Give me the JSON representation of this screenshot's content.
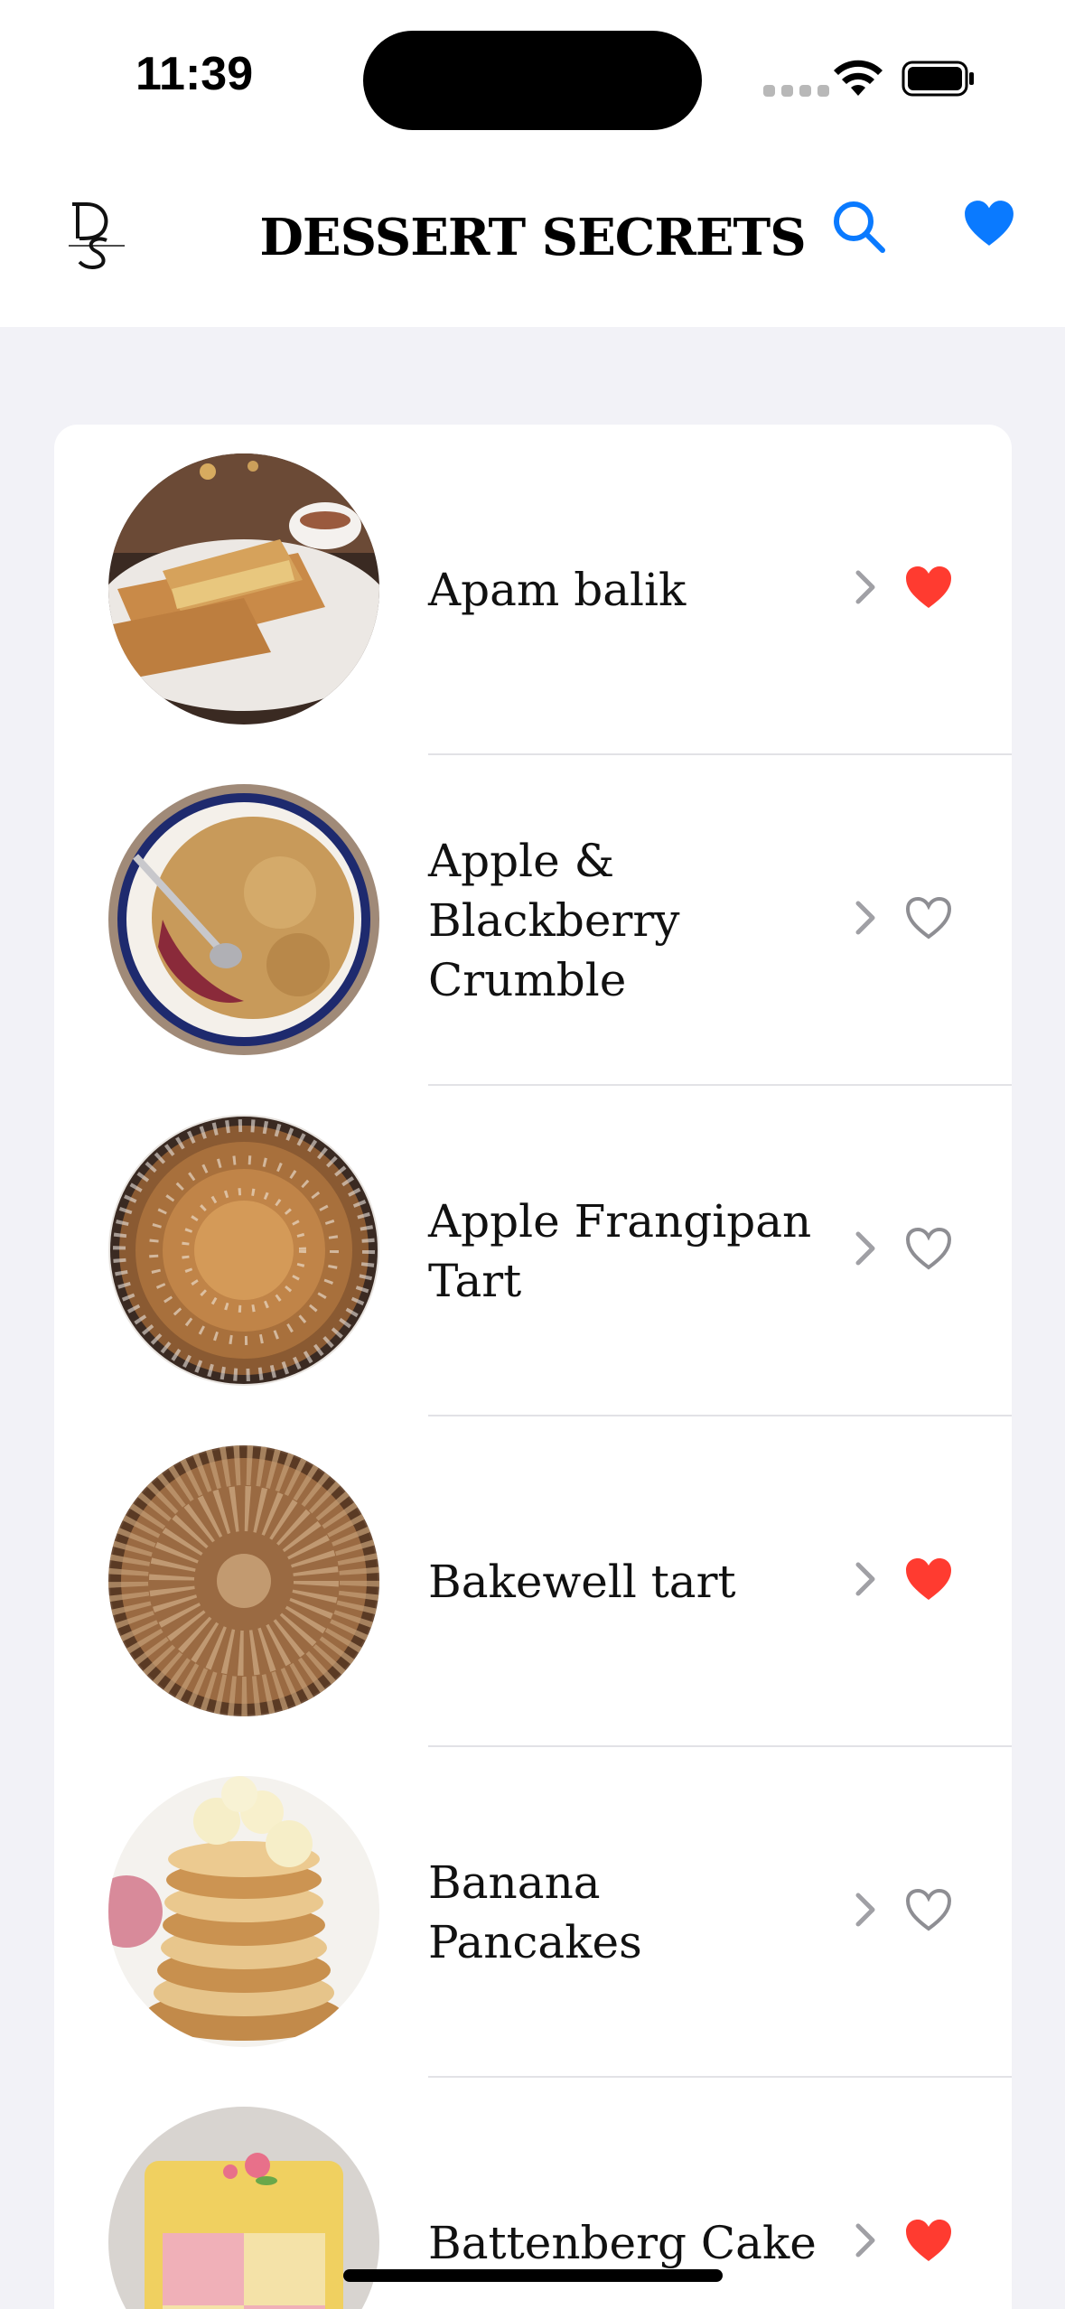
{
  "status_bar": {
    "time": "11:39"
  },
  "header": {
    "title": "DESSERT SECRETS",
    "logo_text": "Dessert Secrets",
    "accent_color": "#0a7aff"
  },
  "desserts": [
    {
      "name": "Apam balik",
      "favorite": true,
      "image": "pancake-turnover-image"
    },
    {
      "name": "Apple & Blackberry Crumble",
      "favorite": false,
      "image": "crumble-image"
    },
    {
      "name": "Apple Frangipan Tart",
      "favorite": false,
      "image": "apple-tart-image"
    },
    {
      "name": "Bakewell tart",
      "favorite": true,
      "image": "bakewell-tart-image"
    },
    {
      "name": "Banana Pancakes",
      "favorite": false,
      "image": "banana-pancakes-image"
    },
    {
      "name": "Battenberg Cake",
      "favorite": true,
      "image": "battenberg-cake-image"
    }
  ],
  "colors": {
    "favorite_filled": "#ff3b30",
    "favorite_empty": "#8e8e93",
    "chevron": "#a0a0a5",
    "background": "#f2f2f7"
  }
}
